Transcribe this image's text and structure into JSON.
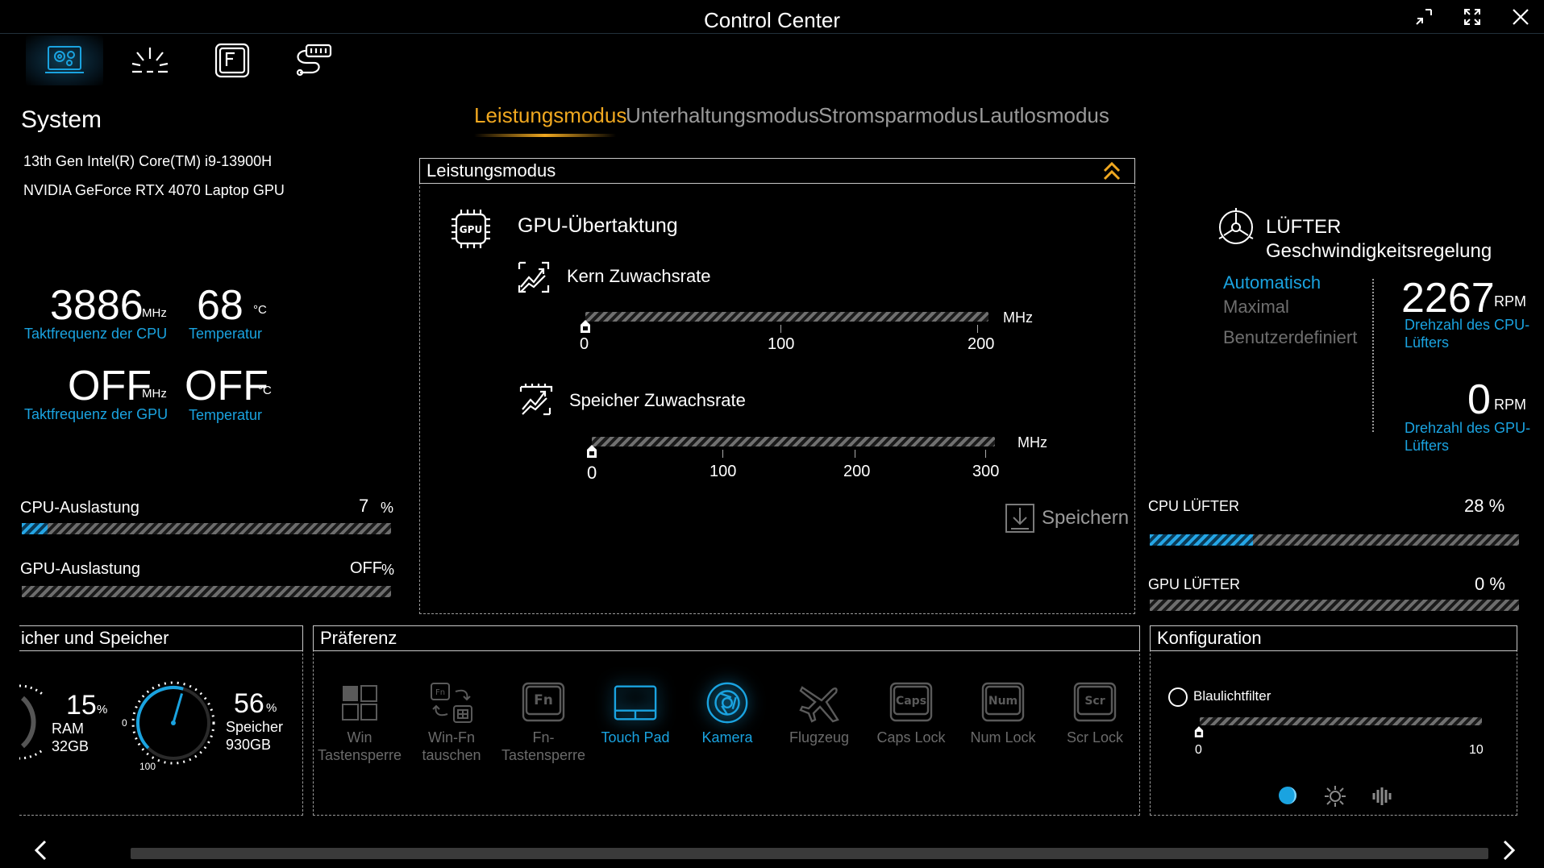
{
  "window": {
    "title": "Control Center"
  },
  "system": {
    "heading": "System",
    "cpu_name": "13th Gen Intel(R) Core(TM) i9-13900H",
    "gpu_name": "NVIDIA GeForce RTX 4070 Laptop GPU",
    "cpu_freq": "3886",
    "cpu_freq_unit": "MHz",
    "cpu_freq_label": "Taktfrequenz der CPU",
    "cpu_temp": "68",
    "cpu_temp_unit": "°C",
    "cpu_temp_label": "Temperatur",
    "gpu_freq": "OFF",
    "gpu_freq_unit": "MHz",
    "gpu_freq_label": "Taktfrequenz der GPU",
    "gpu_temp": "OFF",
    "gpu_temp_unit": "°C",
    "gpu_temp_label": "Temperatur",
    "cpu_load_label": "CPU-Auslastung",
    "cpu_load_value": "7",
    "cpu_load_unit": "%",
    "cpu_load_fraction": 0.07,
    "gpu_load_label": "GPU-Auslastung",
    "gpu_load_value": "OFF",
    "gpu_load_unit": "%",
    "gpu_load_fraction": 0
  },
  "mode_tabs": [
    "Leistungsmodus",
    "Unterhaltungsmodus",
    "Stromsparmodus",
    "Lautlosmodus"
  ],
  "active_mode_index": 0,
  "center": {
    "box_title": "Leistungsmodus",
    "gpu_oc_title": "GPU-Übertaktung",
    "core_title": "Kern Zuwachsrate",
    "core_unit": "MHz",
    "core_ticks": [
      "0",
      "100",
      "200"
    ],
    "core_value": 0,
    "mem_title": "Speicher Zuwachsrate",
    "mem_unit": "MHz",
    "mem_ticks": [
      "0",
      "100",
      "200",
      "300"
    ],
    "mem_value": 0,
    "save_label": "Speichern"
  },
  "fan": {
    "title_line1": "LÜFTER",
    "title_line2": "Geschwindigkeitsregelung",
    "options": [
      "Automatisch",
      "Maximal",
      "Benutzerdefiniert"
    ],
    "active_option_index": 0,
    "cpu_rpm": "2267",
    "rpm_unit": "RPM",
    "cpu_rpm_label_1": "Drehzahl des CPU-",
    "cpu_rpm_label_2": "Lüfters",
    "gpu_rpm": "0",
    "gpu_rpm_label_1": "Drehzahl des GPU-",
    "gpu_rpm_label_2": "Lüfters",
    "cpu_fan_label": "CPU LÜFTER",
    "cpu_fan_value": "28 %",
    "cpu_fan_fraction": 0.28,
    "gpu_fan_label": "GPU LÜFTER",
    "gpu_fan_value": "0 %",
    "gpu_fan_fraction": 0
  },
  "memory": {
    "title": "icher und Speicher",
    "ram_pct": "15",
    "ram_label": "RAM",
    "ram_size": "32GB",
    "gauge_min": "0",
    "gauge_max": "100",
    "storage_pct": "56",
    "storage_label": "Speicher",
    "storage_size": "930GB",
    "pct_unit": "%"
  },
  "preference": {
    "title": "Präferenz",
    "items": [
      {
        "l1": "Win",
        "l2": "Tastensperre",
        "icon": "windows-icon",
        "on": false
      },
      {
        "l1": "Win-Fn",
        "l2": "tauschen",
        "icon": "swap-icon",
        "on": false
      },
      {
        "l1": "Fn-",
        "l2": "Tastensperre",
        "icon": "fn-key-icon",
        "on": false,
        "key": "Fn"
      },
      {
        "l1": "Touch Pad",
        "l2": "",
        "icon": "touchpad-icon",
        "on": true
      },
      {
        "l1": "Kamera",
        "l2": "",
        "icon": "camera-icon",
        "on": true
      },
      {
        "l1": "Flugzeug",
        "l2": "",
        "icon": "airplane-icon",
        "on": false
      },
      {
        "l1": "Caps Lock",
        "l2": "",
        "icon": "caps-key-icon",
        "on": false,
        "key": "Caps"
      },
      {
        "l1": "Num Lock",
        "l2": "",
        "icon": "num-key-icon",
        "on": false,
        "key": "Num"
      },
      {
        "l1": "Scr Lock",
        "l2": "",
        "icon": "scr-key-icon",
        "on": false,
        "key": "Scr"
      }
    ]
  },
  "config": {
    "title": "Konfiguration",
    "bluelight_label": "Blaulichtfilter",
    "min": "0",
    "max": "10",
    "value": 0
  },
  "colors": {
    "accent": "#1aa3e0",
    "active_tab": "#f0a820",
    "muted": "#8a8a8a"
  }
}
